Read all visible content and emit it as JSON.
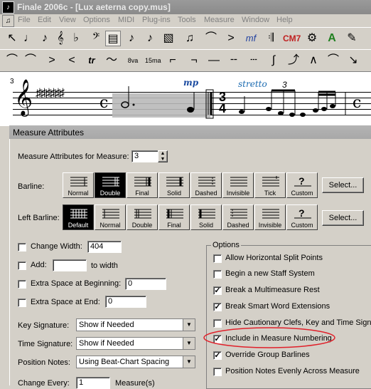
{
  "window": {
    "title": "Finale 2006c - [Lux aeterna copy.mus]"
  },
  "menu": [
    "File",
    "Edit",
    "View",
    "Options",
    "MIDI",
    "Plug-ins",
    "Tools",
    "Measure",
    "Window",
    "Help"
  ],
  "score": {
    "measure_number": "3",
    "dynamic_mark": "mp",
    "tempo_text": "stretto",
    "tuplet": "3",
    "time_sig_top": "3",
    "time_sig_bottom": "4"
  },
  "dialog": {
    "title": "Measure Attributes",
    "measure_label": "Measure Attributes for Measure:",
    "measure_value": "3",
    "barline_label": "Barline:",
    "barline_options": [
      "Normal",
      "Double",
      "Final",
      "Solid",
      "Dashed",
      "Invisible",
      "Tick",
      "Custom"
    ],
    "barline_selected": "Double",
    "left_barline_label": "Left Barline:",
    "left_barline_options": [
      "Default",
      "Normal",
      "Double",
      "Final",
      "Solid",
      "Dashed",
      "Invisible",
      "Custom"
    ],
    "left_barline_selected": "Default",
    "select_button": "Select...",
    "change_width_label": "Change Width:",
    "change_width_value": "404",
    "add_label": "Add:",
    "add_value": "",
    "to_width_label": "to width",
    "extra_begin_label": "Extra Space at Beginning:",
    "extra_begin_value": "0",
    "extra_end_label": "Extra Space at End:",
    "extra_end_value": "0",
    "key_sig_label": "Key Signature:",
    "key_sig_value": "Show if Needed",
    "time_sig_label": "Time Signature:",
    "time_sig_value": "Show if Needed",
    "position_notes_label": "Position Notes:",
    "position_notes_value": "Using Beat-Chart Spacing",
    "change_every_label": "Change Every:",
    "change_every_value": "1",
    "measures_label": "Measure(s)",
    "options_title": "Options",
    "options": [
      {
        "label": "Allow Horizontal Split Points",
        "checked": false
      },
      {
        "label": "Begin a new Staff System",
        "checked": false
      },
      {
        "label": "Break a Multimeasure Rest",
        "checked": true
      },
      {
        "label": "Break Smart Word Extensions",
        "checked": true
      },
      {
        "label": "Hide Cautionary Clefs, Key and Time Signat",
        "checked": false
      },
      {
        "label": "Include in Measure Numbering",
        "checked": true
      },
      {
        "label": "Override Group Barlines",
        "checked": true
      },
      {
        "label": "Position Notes Evenly Across Measure",
        "checked": false
      }
    ],
    "highlight_color": "#e0202a"
  }
}
